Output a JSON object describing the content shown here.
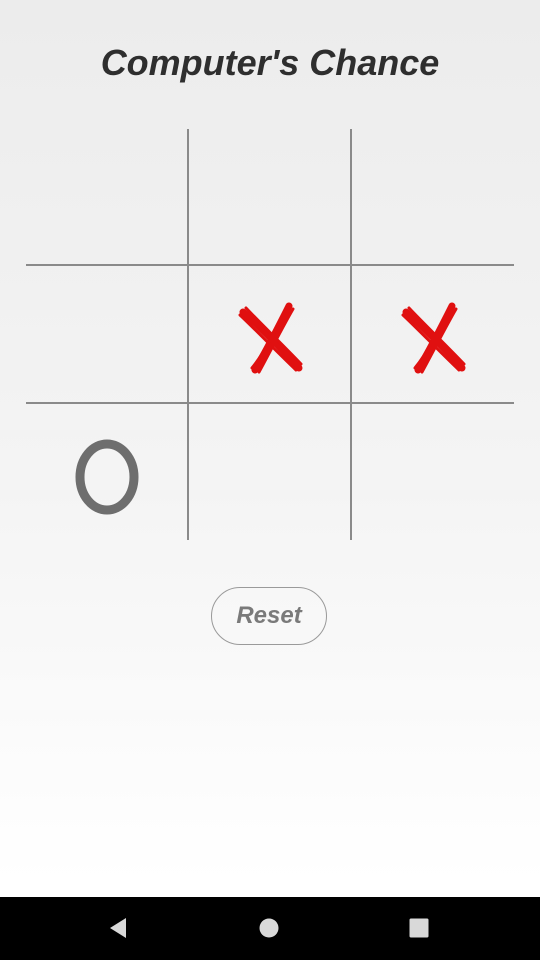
{
  "title": "Computer's Chance",
  "board": {
    "cells": [
      "",
      "",
      "",
      "",
      "X",
      "X",
      "O",
      "",
      ""
    ]
  },
  "reset_label": "Reset",
  "colors": {
    "x_mark": "#e01010",
    "o_mark": "#6e6e6e",
    "grid": "#8a8a8a",
    "nav_icon": "#d9d9d9"
  },
  "navbar": {
    "icons": [
      "back-icon",
      "home-icon",
      "recents-icon"
    ]
  }
}
